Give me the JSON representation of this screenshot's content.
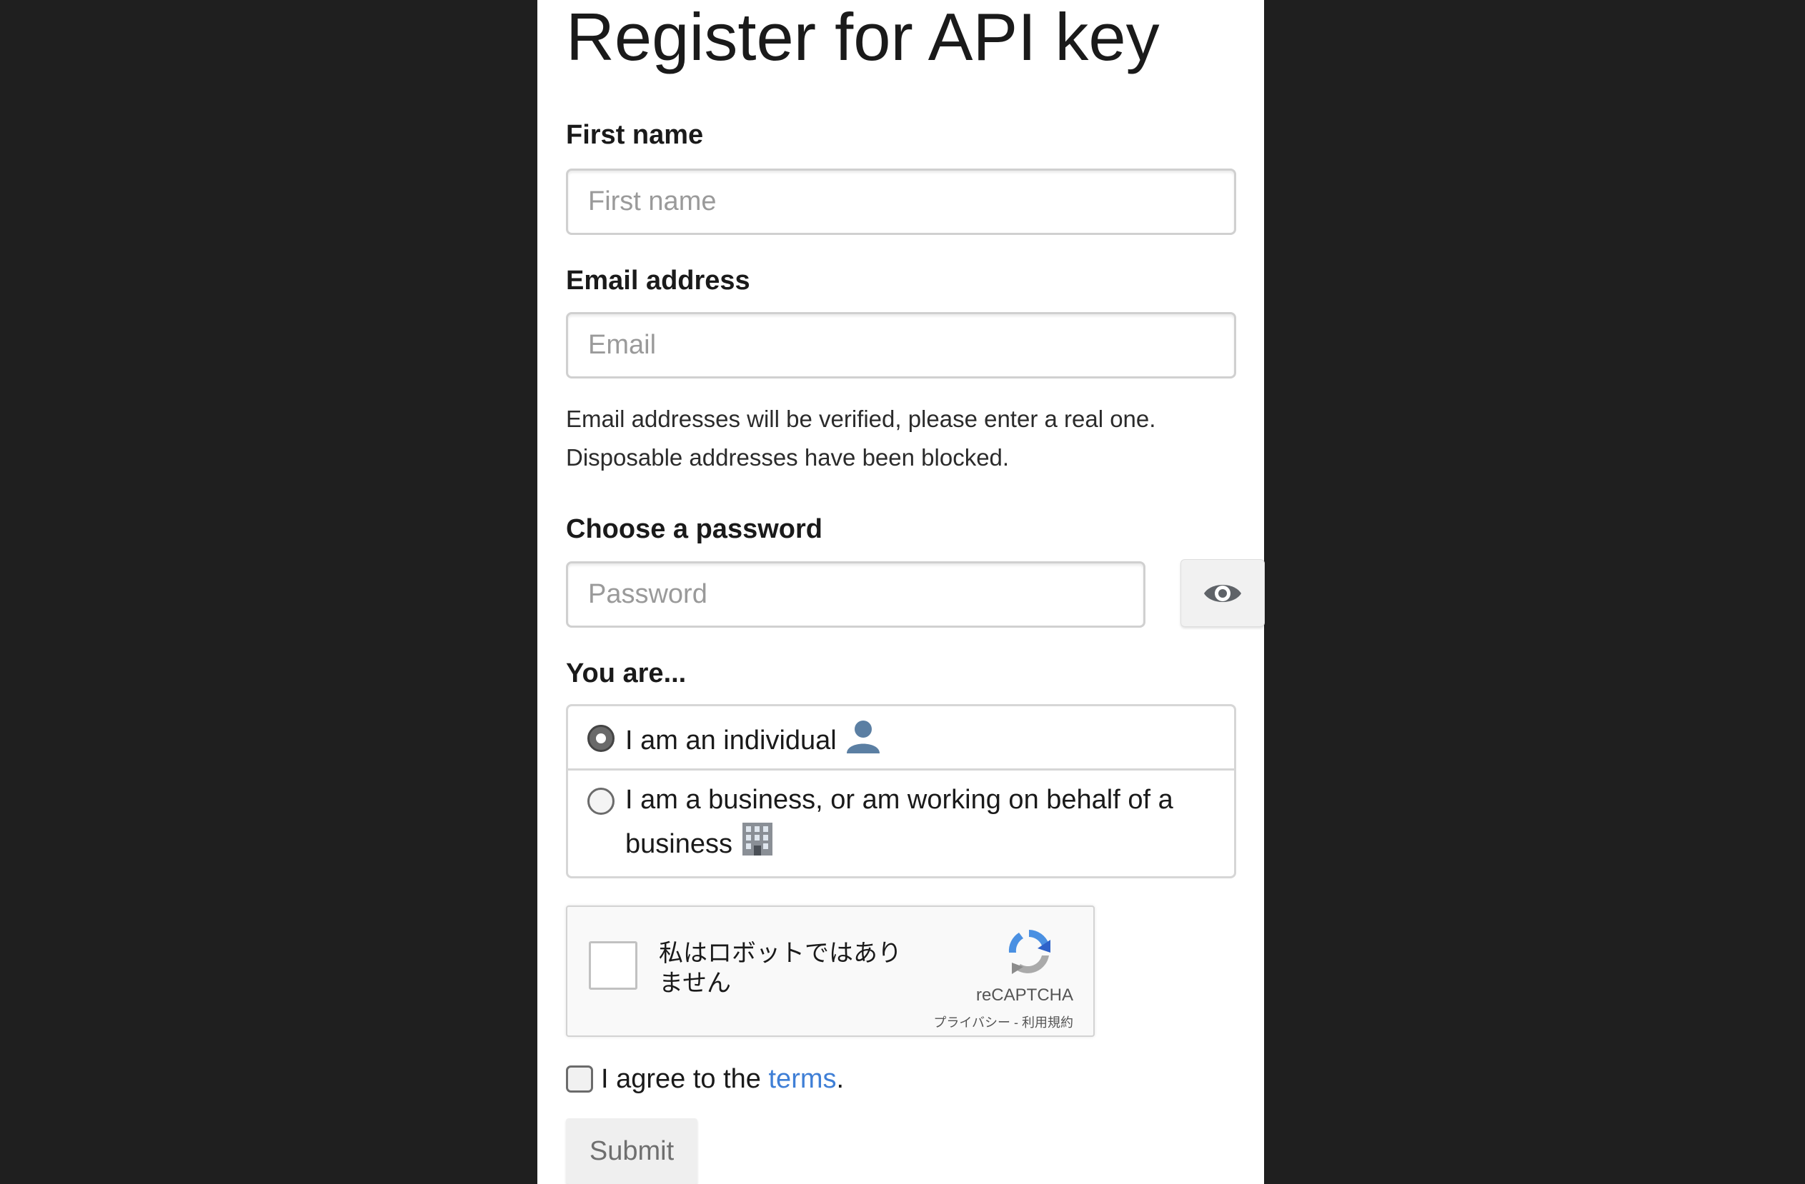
{
  "page": {
    "title": "Register for API key"
  },
  "form": {
    "first_name": {
      "label": "First name",
      "placeholder": "First name",
      "value": ""
    },
    "email": {
      "label": "Email address",
      "placeholder": "Email",
      "value": "",
      "help_line1": "Email addresses will be verified, please enter a real one.",
      "help_line2": "Disposable addresses have been blocked."
    },
    "password": {
      "label": "Choose a password",
      "placeholder": "Password",
      "value": "",
      "toggle_icon": "eye-icon"
    },
    "account_type": {
      "label": "You are...",
      "options": [
        {
          "label": "I am an individual",
          "icon": "person-silhouette-icon",
          "selected": true
        },
        {
          "label": "I am a business, or am working on behalf of a business",
          "icon": "office-building-icon",
          "selected": false
        }
      ]
    },
    "captcha": {
      "text": "私はロボットではありません",
      "brand": "reCAPTCHA",
      "privacy": "プライバシー",
      "separator": "-",
      "terms": "利用規約",
      "checked": false
    },
    "agree": {
      "prefix": "I agree to the ",
      "link": "terms",
      "suffix": ".",
      "checked": false
    },
    "submit_label": "Submit"
  },
  "colors": {
    "background": "#1f1f1f",
    "panel": "#ffffff",
    "link": "#3f7fd6"
  }
}
